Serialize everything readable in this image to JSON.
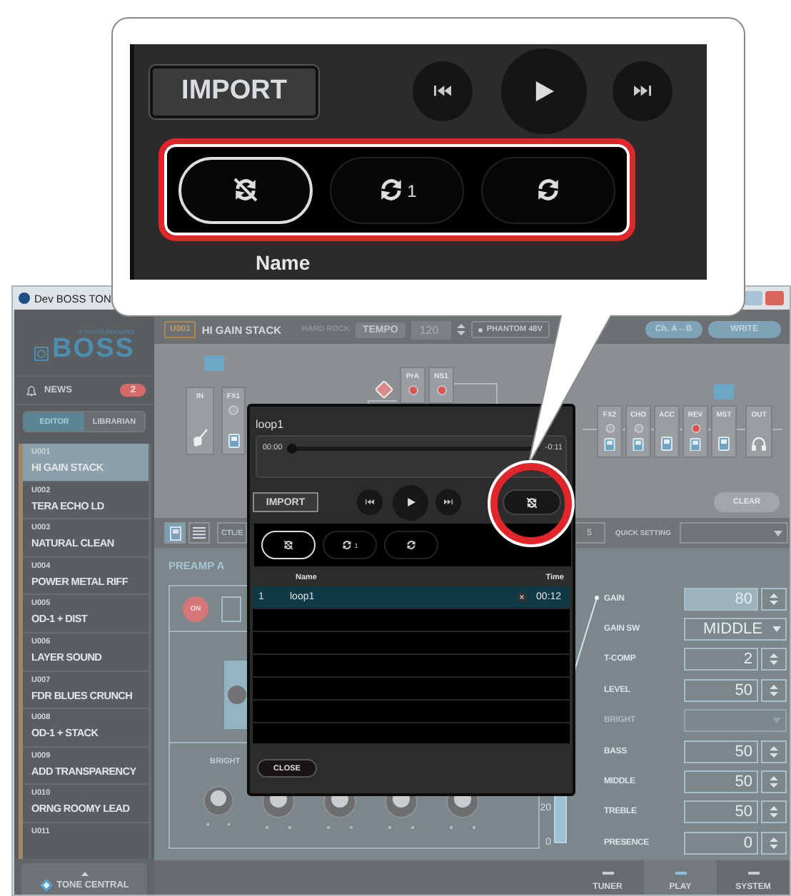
{
  "callout": {
    "import": "IMPORT",
    "loop_modes": [
      {
        "kind": "off",
        "selected": true
      },
      {
        "kind": "one",
        "badge": "1",
        "selected": false
      },
      {
        "kind": "all",
        "selected": false
      }
    ],
    "column": "Name"
  },
  "window": {
    "title": "Dev BOSS TON"
  },
  "sidebar": {
    "logo_tagline": "a sound innovator",
    "logo": "BOSS",
    "news": {
      "label": "NEWS",
      "count": "2"
    },
    "tabs": [
      {
        "label": "EDITOR",
        "selected": true
      },
      {
        "label": "LIBRARIAN",
        "selected": false
      }
    ],
    "patches": [
      {
        "code": "U001",
        "name": "HI GAIN STACK",
        "selected": true
      },
      {
        "code": "U002",
        "name": "TERA ECHO LD",
        "selected": false
      },
      {
        "code": "U003",
        "name": "NATURAL CLEAN",
        "selected": false
      },
      {
        "code": "U004",
        "name": "POWER METAL RIFF",
        "selected": false
      },
      {
        "code": "U005",
        "name": "OD-1 + DIST",
        "selected": false
      },
      {
        "code": "U006",
        "name": "LAYER SOUND",
        "selected": false
      },
      {
        "code": "U007",
        "name": "FDR BLUES CRUNCH",
        "selected": false
      },
      {
        "code": "U008",
        "name": "OD-1 + STACK",
        "selected": false
      },
      {
        "code": "U009",
        "name": "ADD TRANSPARENCY",
        "selected": false
      },
      {
        "code": "U010",
        "name": "ORNG ROOMY LEAD",
        "selected": false
      },
      {
        "code": "U011",
        "selected": false
      }
    ],
    "tone_central": "TONE CENTRAL"
  },
  "header": {
    "patch_code": "U001",
    "patch_name": "HI GAIN STACK",
    "genre": "HARD ROCK",
    "tempo_label": "TEMPO",
    "tempo": "120",
    "phantom": "PHANTOM 48V",
    "channel_swap": "Ch. A↔B",
    "write": "WRITE"
  },
  "chain": {
    "blocks": [
      {
        "label": "IN",
        "kind": "input"
      },
      {
        "label": "FX1",
        "kind": "effect",
        "on": false
      },
      {
        "label": "PrA",
        "kind": "effect",
        "on": true
      },
      {
        "label": "NS1",
        "kind": "effect",
        "on": true
      },
      {
        "label": "FX2",
        "kind": "effect",
        "on": false
      },
      {
        "label": "CHO",
        "kind": "effect",
        "on": false
      },
      {
        "label": "ACC",
        "kind": "plain"
      },
      {
        "label": "REV",
        "kind": "effect",
        "on": true
      },
      {
        "label": "MST",
        "kind": "plain"
      },
      {
        "label": "OUT",
        "kind": "output"
      }
    ],
    "clear": "CLEAR"
  },
  "toolbar": {
    "views": [
      {
        "kind": "blocks",
        "selected": true
      },
      {
        "kind": "list",
        "selected": false
      }
    ],
    "ctl": "CTL/E",
    "number": "5",
    "quick_setting": "QUICK SETTING"
  },
  "preamp": {
    "title": "PREAMP A",
    "on_label": "ON",
    "on": true,
    "bright_label": "BRIGHT",
    "params": [
      {
        "label": "GAIN",
        "kind": "number",
        "value": "80",
        "selected": true,
        "disabled": false
      },
      {
        "label": "GAIN SW",
        "kind": "select",
        "value": "MIDDLE",
        "selected": false,
        "disabled": false
      },
      {
        "label": "T-COMP",
        "kind": "number",
        "value": "2",
        "selected": false,
        "disabled": false
      },
      {
        "label": "LEVEL",
        "kind": "number",
        "value": "50",
        "selected": false,
        "disabled": false
      },
      {
        "label": "BRIGHT",
        "kind": "select",
        "selected": false,
        "disabled": true
      },
      {
        "label": "BASS",
        "kind": "number",
        "value": "50",
        "selected": false,
        "disabled": false
      },
      {
        "label": "MIDDLE",
        "kind": "number",
        "value": "50",
        "selected": false,
        "disabled": false
      },
      {
        "label": "TREBLE",
        "kind": "number",
        "value": "50",
        "selected": false,
        "disabled": false
      },
      {
        "label": "PRESENCE",
        "kind": "number",
        "value": "0",
        "selected": false,
        "disabled": false
      }
    ],
    "meter_scale": [
      "20",
      "0"
    ]
  },
  "footer_tabs": [
    {
      "label": "TUNER",
      "selected": false
    },
    {
      "label": "PLAY",
      "selected": true
    },
    {
      "label": "SYSTEM",
      "selected": false
    }
  ],
  "dialog": {
    "title": "loop1",
    "position": "00:00",
    "remaining": "-0:11",
    "level": 0,
    "import": "IMPORT",
    "loop_modes": [
      {
        "kind": "off",
        "selected": true
      },
      {
        "kind": "one",
        "badge": "1",
        "selected": false
      },
      {
        "kind": "all",
        "selected": false
      }
    ],
    "columns": [
      "Name",
      "Time"
    ],
    "rows": [
      {
        "index": "1",
        "name": "loop1",
        "time": "00:12",
        "selected": true
      }
    ],
    "close": "CLOSE"
  }
}
